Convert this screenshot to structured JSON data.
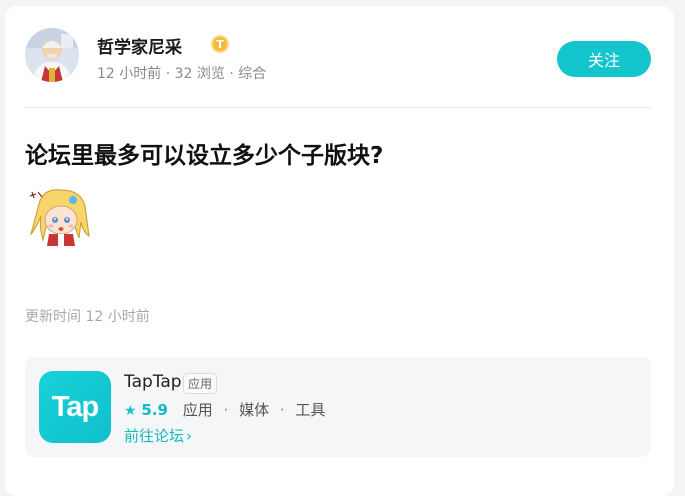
{
  "post": {
    "author": {
      "name": "哲学家尼采",
      "badge": "T"
    },
    "meta": {
      "time": "12 小时前",
      "views": "32 浏览",
      "category": "综合",
      "separator": "·"
    },
    "follow_label": "关注",
    "title": "论坛里最多可以设立多少个子版块?",
    "updated": "更新时间 12 小时前"
  },
  "app_card": {
    "icon_text": "Tap",
    "name": "TapTap",
    "tag": "应用",
    "rating": "5.9",
    "categories": [
      "应用",
      "媒体",
      "工具"
    ],
    "separator": "·",
    "forum_link": "前往论坛"
  },
  "colors": {
    "accent": "#15c5ce",
    "badge": "#f5b93f"
  }
}
